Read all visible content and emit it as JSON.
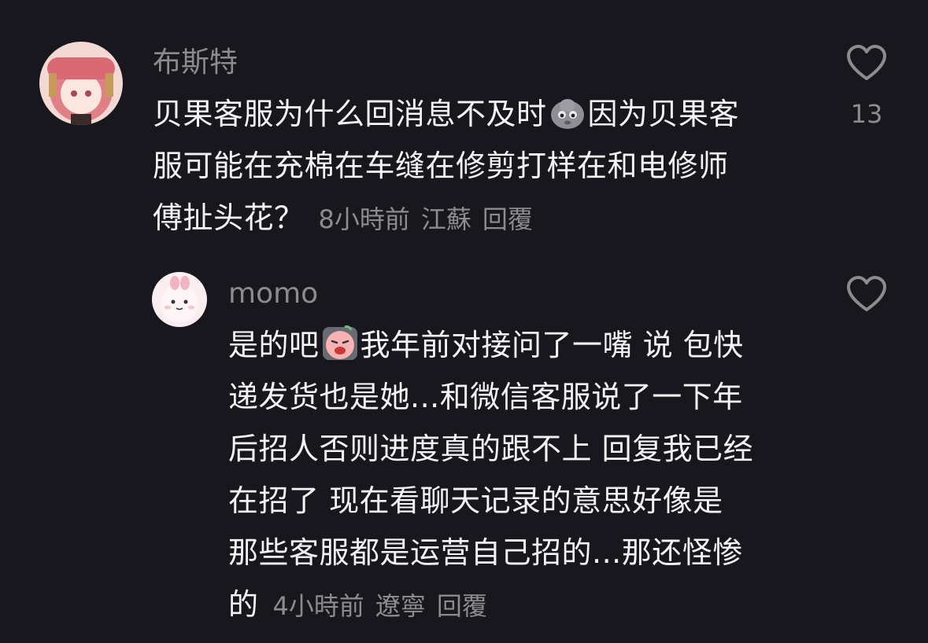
{
  "comments": [
    {
      "username": "布斯特",
      "lines": [
        "贝果客服为什么回消息不及时",
        "因为贝果客",
        "服可能在充棉在车缝在修剪打样在和电修师",
        "傅扯头花？"
      ],
      "emoji": "silly-face-emoji",
      "time": "8小時前",
      "location": "江蘇",
      "reply": "回覆",
      "likes": "13"
    },
    {
      "username": "momo",
      "line1_a": "是的吧",
      "line1_b": "我年前对接问了一嘴 说 包快",
      "lines": [
        "递发货也是她...和微信客服说了一下年",
        "后招人否则进度真的跟不上 回复我已经",
        "在招了 现在看聊天记录的意思好像是",
        "那些客服都是运营自己招的...那还怪惨",
        "的"
      ],
      "emoji": "crying-face-emoji",
      "time": "4小時前",
      "location": "遼寧",
      "reply": "回覆",
      "likes": ""
    }
  ],
  "colors": {
    "background": "#18171d",
    "text_primary": "#f4f4f5",
    "text_secondary": "#8c8b90"
  }
}
